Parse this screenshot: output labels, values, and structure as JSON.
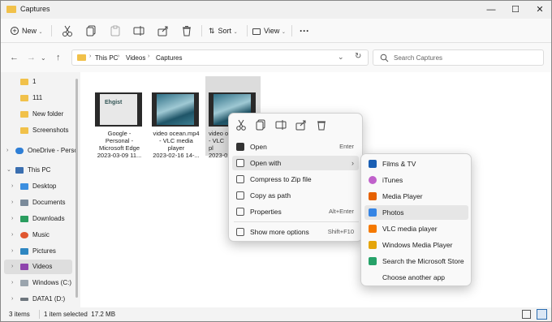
{
  "window": {
    "title": "Captures"
  },
  "toolbar": {
    "new_label": "New",
    "sort_label": "Sort",
    "view_label": "View",
    "more_label": "···"
  },
  "address": {
    "crumbs": [
      "This PC",
      "Videos",
      "Captures"
    ],
    "search_placeholder": "Search Captures"
  },
  "sidebar": {
    "items": [
      {
        "label": "1"
      },
      {
        "label": "111"
      },
      {
        "label": "New folder"
      },
      {
        "label": "Screenshots"
      },
      {
        "label": "OneDrive - Perso"
      },
      {
        "label": "This PC"
      },
      {
        "label": "Desktop"
      },
      {
        "label": "Documents"
      },
      {
        "label": "Downloads"
      },
      {
        "label": "Music"
      },
      {
        "label": "Pictures"
      },
      {
        "label": "Videos"
      },
      {
        "label": "Windows (C:)"
      },
      {
        "label": "DATA1 (D:)"
      }
    ]
  },
  "files": [
    {
      "line1": "Google -",
      "line2": "Personal -",
      "line3": "Microsoft Edge",
      "line4": "2023-03-09 11..."
    },
    {
      "line1": "video ocean.mp4",
      "line2": "- VLC media",
      "line3": "player",
      "line4": "2023-02-16 14-..."
    },
    {
      "line1": "video o",
      "line2": "- VLC",
      "line3": "pl",
      "line4": "2023-02"
    }
  ],
  "context_menu": {
    "items": [
      {
        "label": "Open",
        "shortcut": "Enter"
      },
      {
        "label": "Open with",
        "shortcut": ""
      },
      {
        "label": "Compress to Zip file",
        "shortcut": ""
      },
      {
        "label": "Copy as path",
        "shortcut": ""
      },
      {
        "label": "Properties",
        "shortcut": "Alt+Enter"
      },
      {
        "label": "Show more options",
        "shortcut": "Shift+F10"
      }
    ]
  },
  "open_with_menu": {
    "items": [
      {
        "label": "Films & TV",
        "color": "#1a5fb4"
      },
      {
        "label": "iTunes",
        "color": "#c061cb"
      },
      {
        "label": "Media Player",
        "color": "#e66100"
      },
      {
        "label": "Photos",
        "color": "#3584e4"
      },
      {
        "label": "VLC media player",
        "color": "#f57900"
      },
      {
        "label": "Windows Media Player",
        "color": "#e5a50a"
      },
      {
        "label": "Search the Microsoft Store",
        "color": "#26a269"
      },
      {
        "label": "Choose another app",
        "color": ""
      }
    ]
  },
  "status": {
    "items_count": "3 items",
    "selection": "1 item selected  17.2 MB"
  }
}
